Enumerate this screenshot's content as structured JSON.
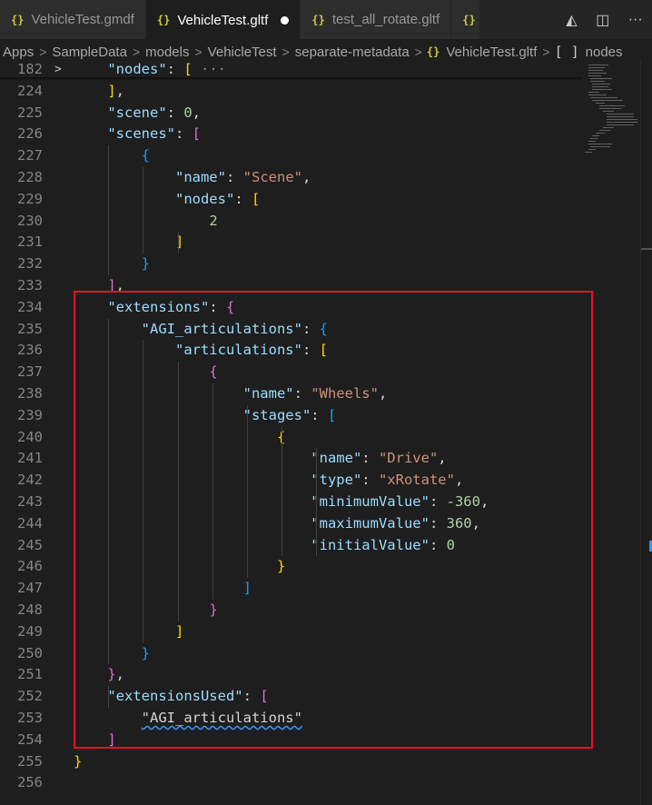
{
  "tabs": [
    {
      "label": "VehicleTest.gmdf",
      "active": false,
      "dirty": false
    },
    {
      "label": "VehicleTest.gltf",
      "active": true,
      "dirty": true
    },
    {
      "label": "test_all_rotate.gltf",
      "active": false,
      "dirty": false
    },
    {
      "label": "",
      "active": false,
      "dirty": false
    }
  ],
  "tab_icon": "{}",
  "tab_actions": {
    "preview_icon": "glTF-preview-icon",
    "split_icon": "split-editor-icon",
    "more_icon": "more-actions-icon",
    "preview_glyph": "◭",
    "split_glyph": "◫",
    "more_glyph": "···"
  },
  "breadcrumb": {
    "items": [
      "Apps",
      "SampleData",
      "models",
      "VehicleTest",
      "separate-metadata"
    ],
    "file": "VehicleTest.gltf",
    "symbol": "nodes",
    "separator": ">",
    "array_glyph": "[ ]"
  },
  "editor": {
    "lines": [
      {
        "num": "182",
        "fold": ">",
        "tokens": [
          [
            "p",
            "    "
          ],
          [
            "k",
            "\"nodes\""
          ],
          [
            "p",
            ": "
          ],
          [
            "b1",
            "["
          ],
          [
            "fold-dots",
            " ···"
          ]
        ]
      },
      {
        "num": "224",
        "tokens": [
          [
            "p",
            "    "
          ],
          [
            "b1",
            "]"
          ],
          [
            "p",
            ","
          ]
        ]
      },
      {
        "num": "225",
        "tokens": [
          [
            "p",
            "    "
          ],
          [
            "k",
            "\"scene\""
          ],
          [
            "p",
            ": "
          ],
          [
            "n",
            "0"
          ],
          [
            "p",
            ","
          ]
        ]
      },
      {
        "num": "226",
        "tokens": [
          [
            "p",
            "    "
          ],
          [
            "k",
            "\"scenes\""
          ],
          [
            "p",
            ": "
          ],
          [
            "b2",
            "["
          ]
        ]
      },
      {
        "num": "227",
        "tokens": [
          [
            "p",
            "        "
          ],
          [
            "b3",
            "{"
          ]
        ]
      },
      {
        "num": "228",
        "tokens": [
          [
            "p",
            "            "
          ],
          [
            "k",
            "\"name\""
          ],
          [
            "p",
            ": "
          ],
          [
            "s",
            "\"Scene\""
          ],
          [
            "p",
            ","
          ]
        ]
      },
      {
        "num": "229",
        "tokens": [
          [
            "p",
            "            "
          ],
          [
            "k",
            "\"nodes\""
          ],
          [
            "p",
            ": "
          ],
          [
            "b1",
            "["
          ]
        ]
      },
      {
        "num": "230",
        "tokens": [
          [
            "p",
            "                "
          ],
          [
            "n",
            "2"
          ]
        ]
      },
      {
        "num": "231",
        "tokens": [
          [
            "p",
            "            "
          ],
          [
            "b1",
            "]"
          ]
        ]
      },
      {
        "num": "232",
        "tokens": [
          [
            "p",
            "        "
          ],
          [
            "b3",
            "}"
          ]
        ]
      },
      {
        "num": "233",
        "tokens": [
          [
            "p",
            "    "
          ],
          [
            "b2",
            "]"
          ],
          [
            "p",
            ","
          ]
        ]
      },
      {
        "num": "234",
        "tokens": [
          [
            "p",
            "    "
          ],
          [
            "k",
            "\"extensions\""
          ],
          [
            "p",
            ": "
          ],
          [
            "b2",
            "{"
          ]
        ]
      },
      {
        "num": "235",
        "tokens": [
          [
            "p",
            "        "
          ],
          [
            "k",
            "\"AGI_articulations\""
          ],
          [
            "p",
            ": "
          ],
          [
            "b3",
            "{"
          ]
        ]
      },
      {
        "num": "236",
        "tokens": [
          [
            "p",
            "            "
          ],
          [
            "k",
            "\"articulations\""
          ],
          [
            "p",
            ": "
          ],
          [
            "b1",
            "["
          ]
        ]
      },
      {
        "num": "237",
        "tokens": [
          [
            "p",
            "                "
          ],
          [
            "b2",
            "{"
          ]
        ]
      },
      {
        "num": "238",
        "tokens": [
          [
            "p",
            "                    "
          ],
          [
            "k",
            "\"name\""
          ],
          [
            "p",
            ": "
          ],
          [
            "s",
            "\"Wheels\""
          ],
          [
            "p",
            ","
          ]
        ]
      },
      {
        "num": "239",
        "tokens": [
          [
            "p",
            "                    "
          ],
          [
            "k",
            "\"stages\""
          ],
          [
            "p",
            ": "
          ],
          [
            "b3",
            "["
          ]
        ]
      },
      {
        "num": "240",
        "tokens": [
          [
            "p",
            "                        "
          ],
          [
            "b1",
            "{"
          ]
        ]
      },
      {
        "num": "241",
        "tokens": [
          [
            "p",
            "                            "
          ],
          [
            "k",
            "\"name\""
          ],
          [
            "p",
            ": "
          ],
          [
            "s",
            "\"Drive\""
          ],
          [
            "p",
            ","
          ]
        ]
      },
      {
        "num": "242",
        "tokens": [
          [
            "p",
            "                            "
          ],
          [
            "k",
            "\"type\""
          ],
          [
            "p",
            ": "
          ],
          [
            "s",
            "\"xRotate\""
          ],
          [
            "p",
            ","
          ]
        ]
      },
      {
        "num": "243",
        "tokens": [
          [
            "p",
            "                            "
          ],
          [
            "k",
            "\"minimumValue\""
          ],
          [
            "p",
            ": "
          ],
          [
            "n",
            "-360"
          ],
          [
            "p",
            ","
          ]
        ]
      },
      {
        "num": "244",
        "tokens": [
          [
            "p",
            "                            "
          ],
          [
            "k",
            "\"maximumValue\""
          ],
          [
            "p",
            ": "
          ],
          [
            "n",
            "360"
          ],
          [
            "p",
            ","
          ]
        ]
      },
      {
        "num": "245",
        "tokens": [
          [
            "p",
            "                            "
          ],
          [
            "k",
            "\"initialValue\""
          ],
          [
            "p",
            ": "
          ],
          [
            "n",
            "0"
          ]
        ]
      },
      {
        "num": "246",
        "tokens": [
          [
            "p",
            "                        "
          ],
          [
            "b1",
            "}"
          ]
        ]
      },
      {
        "num": "247",
        "tokens": [
          [
            "p",
            "                    "
          ],
          [
            "b3",
            "]"
          ]
        ]
      },
      {
        "num": "248",
        "tokens": [
          [
            "p",
            "                "
          ],
          [
            "b2",
            "}"
          ]
        ]
      },
      {
        "num": "249",
        "tokens": [
          [
            "p",
            "            "
          ],
          [
            "b1",
            "]"
          ]
        ]
      },
      {
        "num": "250",
        "tokens": [
          [
            "p",
            "        "
          ],
          [
            "b3",
            "}"
          ]
        ]
      },
      {
        "num": "251",
        "tokens": [
          [
            "p",
            "    "
          ],
          [
            "b2",
            "}"
          ],
          [
            "p",
            ","
          ]
        ]
      },
      {
        "num": "252",
        "tokens": [
          [
            "p",
            "    "
          ],
          [
            "k",
            "\"extensionsUsed\""
          ],
          [
            "p",
            ": "
          ],
          [
            "b2",
            "["
          ]
        ]
      },
      {
        "num": "253",
        "tokens": [
          [
            "p",
            "        "
          ],
          [
            "squiggle",
            "\"AGI_articulations\""
          ]
        ]
      },
      {
        "num": "254",
        "tokens": [
          [
            "p",
            "    "
          ],
          [
            "b2",
            "]"
          ]
        ]
      },
      {
        "num": "255",
        "tokens": [
          [
            "b1",
            "}"
          ]
        ]
      },
      {
        "num": "256",
        "tokens": []
      }
    ]
  },
  "colors": {
    "key": "#9cdcfe",
    "string": "#ce9178",
    "number": "#b5cea8",
    "bracket_gold": "#ffd700",
    "bracket_purple": "#da70d6",
    "bracket_blue": "#179fff",
    "highlight_box": "#e81123"
  }
}
